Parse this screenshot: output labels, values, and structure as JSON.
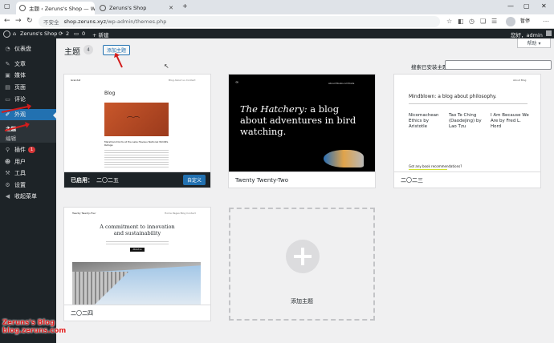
{
  "browser": {
    "tabs": [
      {
        "title": "主题 ‹ Zeruns's Shop — WordPress",
        "active": true
      },
      {
        "title": "Zeruns's Shop",
        "active": false
      }
    ],
    "new_tab": "+",
    "security_label": "不安全",
    "url_host": "shop.zeruns.xyz",
    "url_path": "/wp-admin/themes.php",
    "pause_label": "暂停"
  },
  "adminbar": {
    "site_name": "Zeruns's Shop",
    "updates_count": "2",
    "comments_count": "0",
    "new_label": "+ 新建",
    "greeting": "您好，admin"
  },
  "sidebar": {
    "items": [
      {
        "label": "仪表盘",
        "icon": "dashboard-icon"
      },
      {
        "label": "文章",
        "icon": "pin-icon"
      },
      {
        "label": "媒体",
        "icon": "media-icon"
      },
      {
        "label": "页面",
        "icon": "page-icon"
      },
      {
        "label": "评论",
        "icon": "comment-icon"
      },
      {
        "label": "外观",
        "icon": "brush-icon"
      },
      {
        "label": "插件",
        "icon": "plugin-icon",
        "badge": "1"
      },
      {
        "label": "用户",
        "icon": "user-icon"
      },
      {
        "label": "工具",
        "icon": "wrench-icon"
      },
      {
        "label": "设置",
        "icon": "settings-icon"
      },
      {
        "label": "收起菜单",
        "icon": "collapse-icon"
      }
    ],
    "submenu": [
      "主题",
      "编辑"
    ]
  },
  "main": {
    "title": "主题",
    "theme_count": "4",
    "add_button": "添加主题",
    "help": "帮助 ▾",
    "search_label": "搜索已安装主题",
    "search_value": "",
    "themes": [
      {
        "name": "二〇二五",
        "active": true,
        "active_prefix": "已启用：",
        "customize": "自定义"
      },
      {
        "name": "Twenty Twenty-Two",
        "active": false
      },
      {
        "name": "二〇二三",
        "active": false
      },
      {
        "name": "二〇二四",
        "active": false
      }
    ],
    "add_new_card": "添加主题"
  },
  "previews": {
    "tt5": {
      "site": "Grandat",
      "heading": "Blog",
      "caption": "Marshland birds at the Lake Havasu National Wildlife Refuge"
    },
    "tt2": {
      "headline_italic": "The Hatchery:",
      "headline_rest": "a blog about adventures in bird watching.",
      "menu": "About  Books  All Posts"
    },
    "tt3": {
      "title": "Mindblown: a blog about philosophy.",
      "posts": [
        "Nicomachean Ethics by Aristotle",
        "Tao Te Ching (Daodejing) by Lao Tzu",
        "I Am Because We Are by Fred L. Hord"
      ],
      "cta": "Got any book recommendations?"
    },
    "tt4": {
      "site": "Twenty Twenty-Four",
      "headline": "A commitment to innovation and sustainability",
      "button": "About us"
    }
  },
  "watermark": {
    "line1": "Zeruns's Blog",
    "line2": "blog.zeruns.com"
  },
  "colors": {
    "admin_dark": "#1d2327",
    "accent": "#2271b1",
    "badge": "#d63638",
    "annotation": "#d21c1c"
  }
}
